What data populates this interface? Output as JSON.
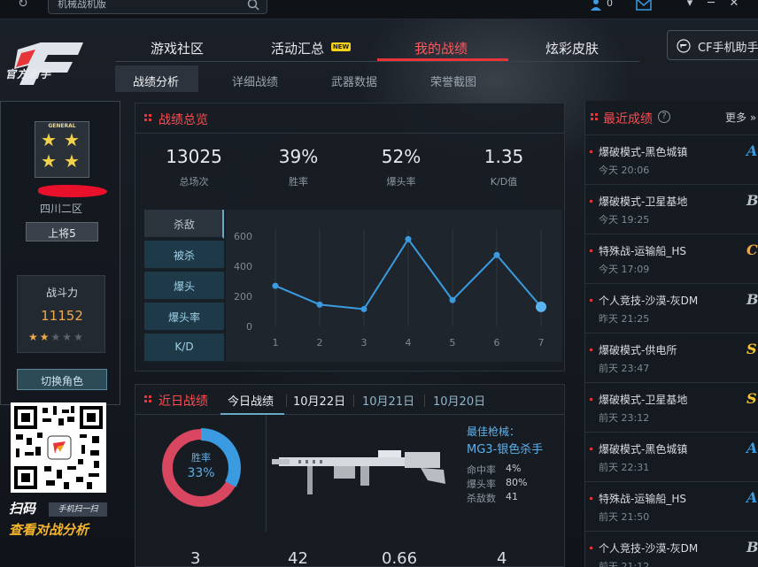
{
  "topbar": {
    "search_value": "机械战机版",
    "coin_count": "0",
    "win_controls": [
      "▾",
      "─",
      "✕"
    ]
  },
  "logo": {
    "text": "官方助手"
  },
  "main_nav": {
    "items": [
      "游戏社区",
      "活动汇总",
      "我的战绩",
      "炫彩皮肤"
    ],
    "active_index": 2,
    "new_badge": "NEW",
    "cf_helper_label": "CF手机助手"
  },
  "sub_nav": {
    "items": [
      "战绩分析",
      "详细战绩",
      "武器数据",
      "荣誉截图"
    ],
    "active_index": 0
  },
  "profile": {
    "rank_badge_text": "GENERAL",
    "server": "四川二区",
    "rank": "上将5",
    "power_label": "战斗力",
    "power_value": "11152",
    "stars_filled": 2,
    "stars_total": 5,
    "switch_label": "切换角色"
  },
  "qr": {
    "scan_text": "扫码",
    "scan_sub": "手机扫一扫",
    "analysis_text": "查看对战分析"
  },
  "overview": {
    "title": "战绩总览",
    "stats": [
      {
        "value": "13025",
        "label": "总场次"
      },
      {
        "value": "39%",
        "label": "胜率"
      },
      {
        "value": "52%",
        "label": "爆头率"
      },
      {
        "value": "1.35",
        "label": "K/D值"
      }
    ],
    "metric_tabs": [
      "杀敌",
      "被杀",
      "爆头",
      "爆头率",
      "K/D"
    ],
    "active_metric": 0
  },
  "chart_data": {
    "type": "line",
    "x": [
      1,
      2,
      3,
      4,
      5,
      6,
      7
    ],
    "values": [
      270,
      145,
      115,
      580,
      175,
      475,
      130
    ],
    "ylim": [
      0,
      600
    ],
    "yticks": [
      0,
      200,
      400,
      600
    ],
    "xticks": [
      1,
      2,
      3,
      4,
      5,
      6,
      7
    ],
    "grid": "vertical",
    "color": "#3a9be0"
  },
  "recent": {
    "title": "最近成绩",
    "more": "更多 »",
    "items": [
      {
        "mode": "爆破模式-黑色城镇",
        "time": "今天 20:06",
        "grade": "A"
      },
      {
        "mode": "爆破模式-卫星基地",
        "time": "今天 19:25",
        "grade": "B"
      },
      {
        "mode": "特殊战-运输船_HS",
        "time": "今天 17:09",
        "grade": "C"
      },
      {
        "mode": "个人竞技-沙漠-灰DM",
        "time": "昨天 21:25",
        "grade": "B"
      },
      {
        "mode": "爆破模式-供电所",
        "time": "前天 23:47",
        "grade": "S"
      },
      {
        "mode": "爆破模式-卫星基地",
        "time": "前天 23:12",
        "grade": "S"
      },
      {
        "mode": "爆破模式-黑色城镇",
        "time": "前天 22:31",
        "grade": "A"
      },
      {
        "mode": "特殊战-运输船_HS",
        "time": "前天 21:50",
        "grade": "A"
      },
      {
        "mode": "个人竞技-沙漠-灰DM",
        "time": "前天 21:12",
        "grade": "B"
      }
    ],
    "grade_colors": {
      "A": "#3a9be0",
      "B": "#b8c0c8",
      "C": "#f0a84a",
      "S": "#f4c430"
    }
  },
  "daily": {
    "title": "近日战绩",
    "tabs": [
      "今日战绩",
      "10月22日",
      "10月21日",
      "10月20日"
    ],
    "active_tab": 0,
    "win_rate_label": "胜率",
    "win_rate_value": "33%",
    "win_rate": 0.33,
    "best_weapon_label": "最佳枪械：",
    "best_weapon_name": "MG3-银色杀手",
    "weapon_stats": [
      {
        "label": "命中率",
        "value": "4%"
      },
      {
        "label": "爆头率",
        "value": "80%"
      },
      {
        "label": "杀敌数",
        "value": "41"
      }
    ],
    "bottom_values": [
      "3",
      "42",
      "0.66",
      "4"
    ]
  }
}
